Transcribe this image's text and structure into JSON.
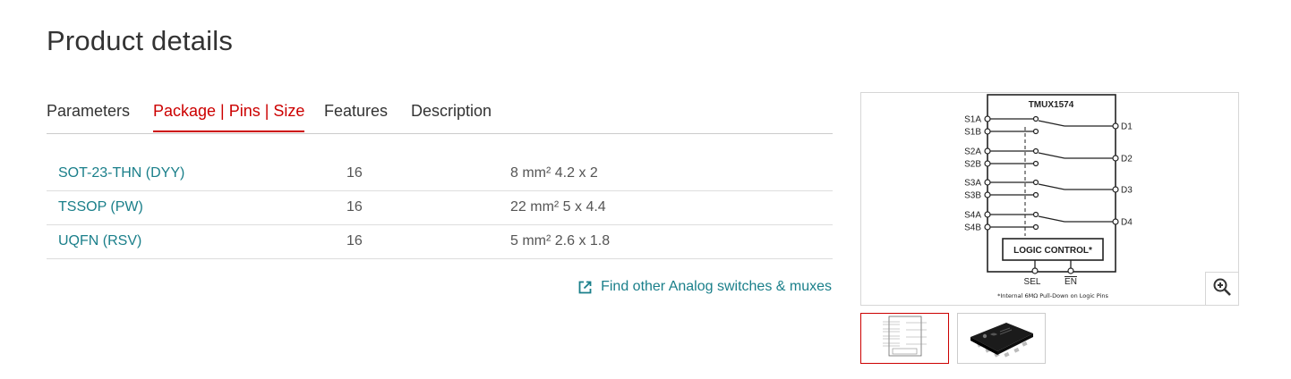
{
  "page": {
    "title": "Product details"
  },
  "tabs": [
    {
      "label": "Parameters",
      "active": false
    },
    {
      "label": "Package | Pins | Size",
      "active": true
    },
    {
      "label": "Features",
      "active": false
    },
    {
      "label": "Description",
      "active": false
    }
  ],
  "packages": [
    {
      "name": "SOT-23-THN (DYY)",
      "pins": "16",
      "size": "8 mm² 4.2 x 2"
    },
    {
      "name": "TSSOP (PW)",
      "pins": "16",
      "size": "22 mm² 5 x 4.4"
    },
    {
      "name": "UQFN (RSV)",
      "pins": "16",
      "size": "5 mm² 2.6 x 1.8"
    }
  ],
  "find_link": {
    "label": "Find other Analog switches & muxes",
    "icon": "external-link-icon"
  },
  "diagram": {
    "chip_name": "TMUX1574",
    "left_pins": [
      "S1A",
      "S1B",
      "S2A",
      "S2B",
      "S3A",
      "S3B",
      "S4A",
      "S4B"
    ],
    "right_pins": [
      "D1",
      "D2",
      "D3",
      "D4"
    ],
    "logic_label": "LOGIC CONTROL*",
    "bottom_pins": [
      "SEL",
      "EN"
    ],
    "footnote": "*Internal 6MΩ Pull-Down on Logic Pins"
  },
  "zoom": {
    "icon": "zoom-in-icon"
  },
  "thumbnails": [
    {
      "name": "functional-diagram-thumbnail",
      "selected": true
    },
    {
      "name": "package-photo-thumbnail",
      "selected": false
    }
  ],
  "colors": {
    "accent": "#cc0000",
    "link": "#1a7f8a",
    "text": "#333333",
    "divider": "#cccccc"
  }
}
